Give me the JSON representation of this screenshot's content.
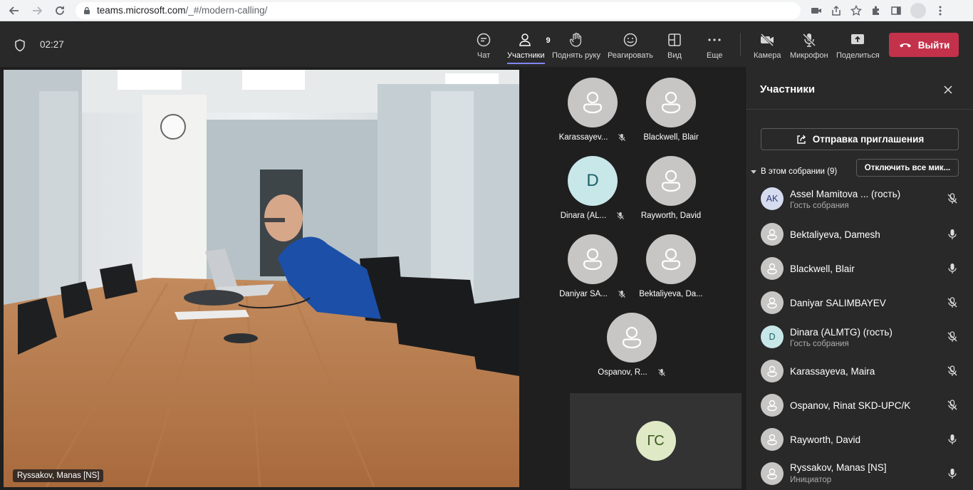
{
  "browser": {
    "url_host": "teams.microsoft.com",
    "url_path": "/_#/modern-calling/"
  },
  "call": {
    "timer": "02:27"
  },
  "toolbar": {
    "chat": "Чат",
    "participants": "Участники",
    "participants_count": "9",
    "raise_hand": "Поднять руку",
    "react": "Реагировать",
    "view": "Вид",
    "more": "Еще",
    "camera": "Камера",
    "mic": "Микрофон",
    "share": "Поделиться",
    "leave": "Выйти"
  },
  "main_video": {
    "name": "Ryssakov, Manas [NS]"
  },
  "gallery": [
    {
      "label": "Karassayev...",
      "muted": true
    },
    {
      "label": "Blackwell, Blair",
      "muted": false
    },
    {
      "label": "Dinara (AL...",
      "initials": "D",
      "muted": true
    },
    {
      "label": "Rayworth, David",
      "muted": false
    },
    {
      "label": "Daniyar SA...",
      "muted": true
    },
    {
      "label": "Bektaliyeva, Da...",
      "muted": false
    },
    {
      "label": "Ospanov, R...",
      "muted": true
    }
  ],
  "self_tile": {
    "initials": "ГС"
  },
  "panel": {
    "title": "Участники",
    "invite": "Отправка приглашения",
    "section": "В этом собрании (9)",
    "mute_all": "Отключить все мик...",
    "participants": [
      {
        "name": "Assel Mamitova ... (гость)",
        "sub": "Гость собрания",
        "initials": "AK",
        "muted": true
      },
      {
        "name": "Bektaliyeva, Damesh",
        "sub": "",
        "muted": false
      },
      {
        "name": "Blackwell, Blair",
        "sub": "",
        "muted": false
      },
      {
        "name": "Daniyar SALIMBAYEV",
        "sub": "",
        "muted": true
      },
      {
        "name": "Dinara (ALMTG) (гость)",
        "sub": "Гость собрания",
        "initials": "D",
        "muted": true
      },
      {
        "name": "Karassayeva, Maira",
        "sub": "",
        "muted": true
      },
      {
        "name": "Ospanov, Rinat SKD-UPC/K",
        "sub": "",
        "muted": true
      },
      {
        "name": "Rayworth, David",
        "sub": "",
        "muted": false
      },
      {
        "name": "Ryssakov, Manas [NS]",
        "sub": "Инициатор",
        "muted": false
      }
    ]
  }
}
